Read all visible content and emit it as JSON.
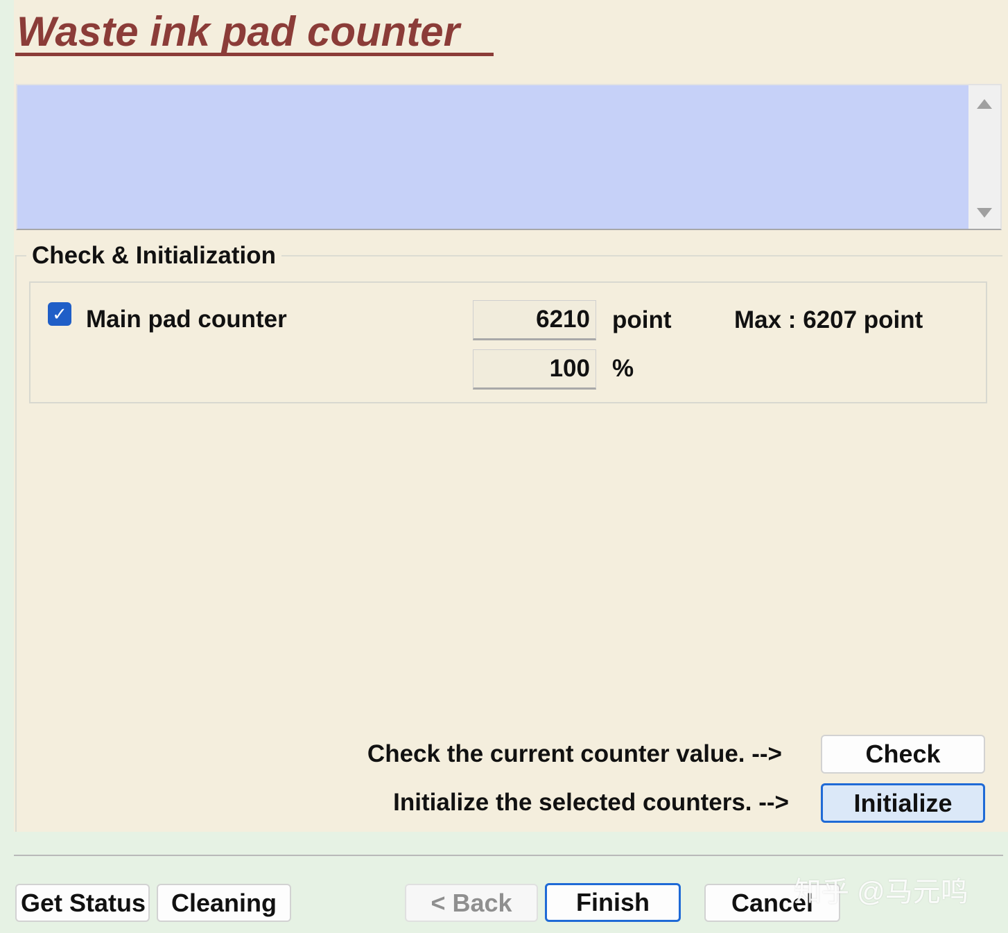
{
  "header": {
    "title": "Waste ink pad counter"
  },
  "group": {
    "legend": "Check & Initialization",
    "counter": {
      "checked": true,
      "label": "Main pad counter",
      "value": "6210",
      "value_unit": "point",
      "max_text": "Max : 6207 point",
      "percent": "100",
      "percent_unit": "%"
    }
  },
  "actions": {
    "check_hint": "Check the current counter value. -->",
    "check_label": "Check",
    "init_hint": "Initialize the selected counters. -->",
    "init_label": "Initialize"
  },
  "footer": {
    "get_status": "Get Status",
    "cleaning": "Cleaning",
    "back": "< Back",
    "finish": "Finish",
    "cancel": "Cancel"
  },
  "watermark": "知乎 @马元鸣",
  "colors": {
    "title": "#8b3c38",
    "panel_bg": "#f4eedd",
    "message_bg": "#c6d1f8",
    "accent": "#1f6ad6"
  },
  "icons": {
    "checkbox": "checkmark-icon",
    "scroll_up": "scroll-up-arrow-icon",
    "scroll_down": "scroll-down-arrow-icon"
  }
}
